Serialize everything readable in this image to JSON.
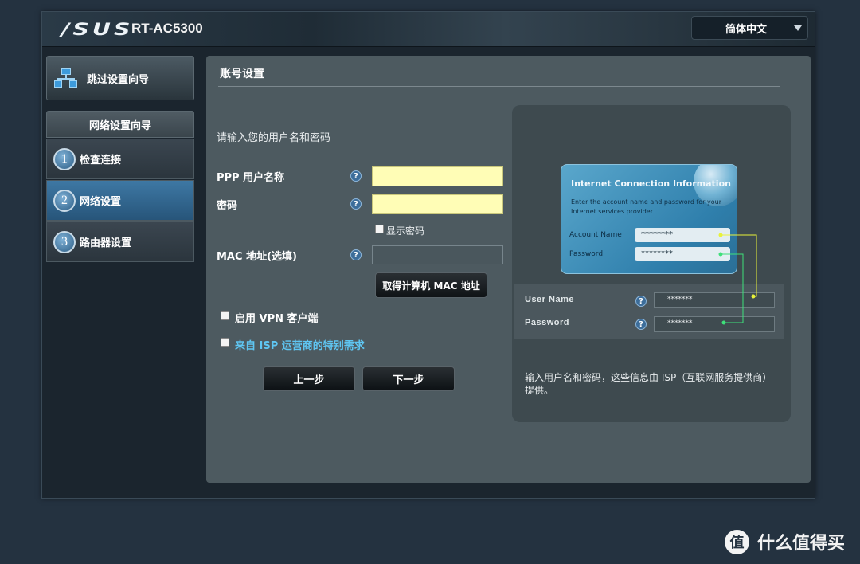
{
  "header": {
    "brand_logo": "/SUS",
    "model": "RT-AC5300",
    "language": "简体中文"
  },
  "sidebar": {
    "skip_label": "跳过设置向导",
    "wizard_title": "网络设置向导",
    "steps": [
      {
        "number": "1",
        "label": "检查连接"
      },
      {
        "number": "2",
        "label": "网络设置"
      },
      {
        "number": "3",
        "label": "路由器设置"
      }
    ]
  },
  "form": {
    "title": "账号设置",
    "prompt": "请输入您的用户名和密码",
    "username_label": "PPP 用户名称",
    "password_label": "密码",
    "username_value": "",
    "password_value": "",
    "show_password_label": "显示密码",
    "mac_label": "MAC 地址(选填)",
    "mac_value": "",
    "get_mac_button": "取得计算机 MAC 地址",
    "vpn_label": "启用 VPN 客户端",
    "isp_label": "来自 ISP 运营商的特别需求",
    "back_button": "上一步",
    "next_button": "下一步",
    "help_glyph": "?"
  },
  "info": {
    "card_title": "Internet Connection Information",
    "card_desc": "Enter the account name and password for your Internet services provider.",
    "card_account_label": "Account Name",
    "card_password_label": "Password",
    "card_account_value": "********",
    "card_password_value": "********",
    "user_name_label": "User Name",
    "password_label": "Password",
    "user_name_value": "*******",
    "password_value": "*******",
    "description": "输入用户名和密码，这些信息由 ISP（互联网服务提供商）提供。"
  },
  "watermark": {
    "icon": "值",
    "text": "什么值得买"
  },
  "colors": {
    "input_highlight": "#fffdb6",
    "link": "#5fc6f2",
    "active_step": "#3e78a4",
    "line_yellow": "#e8f23a",
    "line_green": "#3ee07a"
  }
}
